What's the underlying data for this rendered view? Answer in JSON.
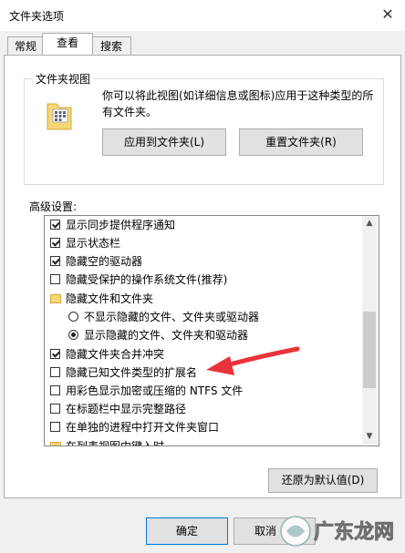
{
  "window": {
    "title": "文件夹选项",
    "close_glyph": "✕"
  },
  "tabs": [
    {
      "label": "常规",
      "active": false
    },
    {
      "label": "查看",
      "active": true
    },
    {
      "label": "搜索",
      "active": false
    }
  ],
  "folder_views": {
    "group_title": "文件夹视图",
    "description": "你可以将此视图(如详细信息或图标)应用于这种类型的所有文件夹。",
    "apply_button": "应用到文件夹(L)",
    "reset_button": "重置文件夹(R)"
  },
  "advanced": {
    "label": "高级设置:",
    "items": [
      {
        "type": "checkbox",
        "checked": true,
        "label": "显示同步提供程序通知"
      },
      {
        "type": "checkbox",
        "checked": true,
        "label": "显示状态栏"
      },
      {
        "type": "checkbox",
        "checked": true,
        "label": "隐藏空的驱动器"
      },
      {
        "type": "checkbox",
        "checked": false,
        "label": "隐藏受保护的操作系统文件(推荐)"
      },
      {
        "type": "folder",
        "label": "隐藏文件和文件夹"
      },
      {
        "type": "radio",
        "checked": false,
        "label": "不显示隐藏的文件、文件夹或驱动器"
      },
      {
        "type": "radio",
        "checked": true,
        "label": "显示隐藏的文件、文件夹和驱动器"
      },
      {
        "type": "checkbox",
        "checked": true,
        "label": "隐藏文件夹合并冲突"
      },
      {
        "type": "checkbox",
        "checked": false,
        "label": "隐藏已知文件类型的扩展名"
      },
      {
        "type": "checkbox",
        "checked": false,
        "label": "用彩色显示加密或压缩的 NTFS 文件"
      },
      {
        "type": "checkbox",
        "checked": false,
        "label": "在标题栏中显示完整路径"
      },
      {
        "type": "checkbox",
        "checked": false,
        "label": "在单独的进程中打开文件夹窗口"
      },
      {
        "type": "folder",
        "label": "在列表视图中键入时"
      }
    ],
    "restore_button": "还原为默认值(D)"
  },
  "footer": {
    "ok_button": "确定",
    "cancel_button": "取消"
  },
  "watermark": {
    "text": "广东龙网"
  },
  "colors": {
    "annotation_arrow": "#e8333a"
  }
}
